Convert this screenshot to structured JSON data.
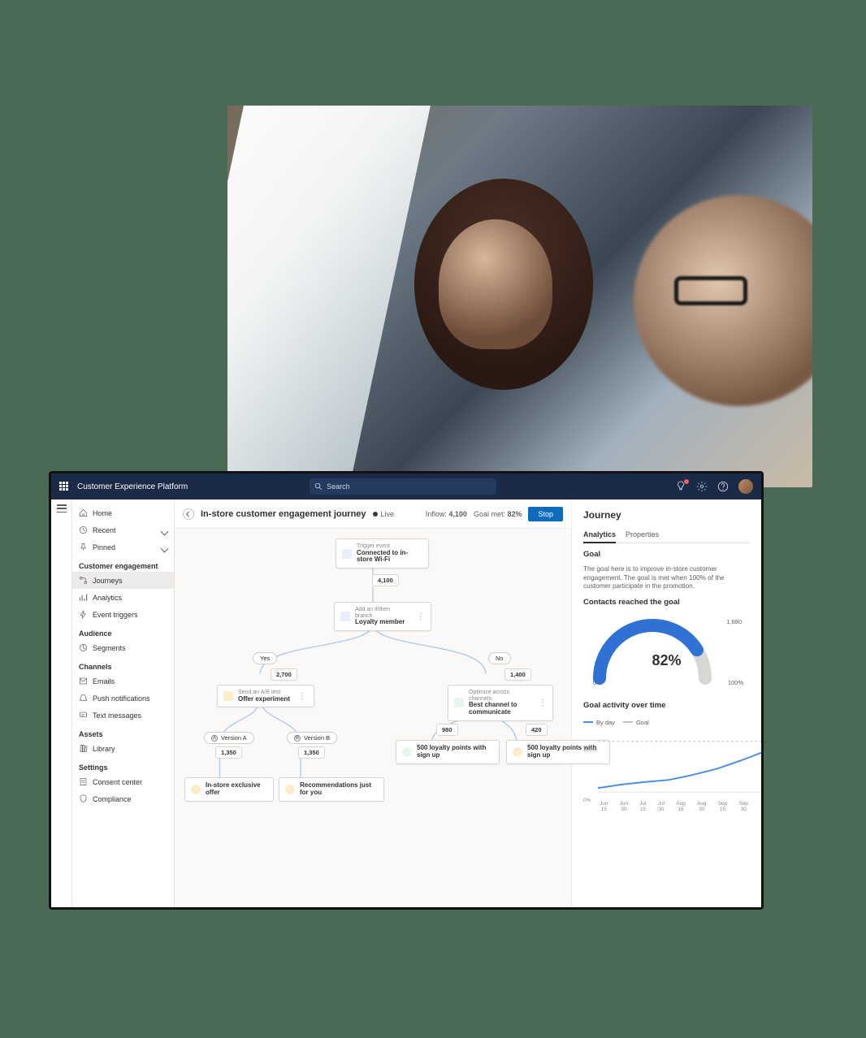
{
  "topbar": {
    "app_title": "Customer Experience Platform",
    "search_placeholder": "Search"
  },
  "sidebar": {
    "items": [
      {
        "icon": "home",
        "label": "Home"
      },
      {
        "icon": "clock",
        "label": "Recent",
        "chev": true
      },
      {
        "icon": "pin",
        "label": "Pinned",
        "chev": true
      }
    ],
    "groups": [
      {
        "title": "Customer engagement",
        "items": [
          {
            "icon": "route",
            "label": "Journeys",
            "active": true
          },
          {
            "icon": "chart",
            "label": "Analytics"
          },
          {
            "icon": "bolt",
            "label": "Event triggers"
          }
        ]
      },
      {
        "title": "Audience",
        "items": [
          {
            "icon": "segment",
            "label": "Segments"
          }
        ]
      },
      {
        "title": "Channels",
        "items": [
          {
            "icon": "mail",
            "label": "Emails"
          },
          {
            "icon": "bell",
            "label": "Push notifications"
          },
          {
            "icon": "sms",
            "label": "Text messages"
          }
        ]
      },
      {
        "title": "Assets",
        "items": [
          {
            "icon": "lib",
            "label": "Library"
          }
        ]
      },
      {
        "title": "Settings",
        "items": [
          {
            "icon": "consent",
            "label": "Consent center"
          },
          {
            "icon": "shield",
            "label": "Compliance"
          }
        ]
      }
    ]
  },
  "header": {
    "title": "In-store customer engagement journey",
    "status": "Live",
    "inflow_label": "Inflow:",
    "inflow_value": "4,100",
    "goal_label": "Goal met:",
    "goal_value": "82%",
    "stop": "Stop"
  },
  "flow": {
    "trigger": {
      "type": "Trigger event",
      "label": "Connected to in-store Wi-Fi"
    },
    "count1": "4,100",
    "attr": {
      "type": "Add an if/then branch",
      "label": "Loyalty member"
    },
    "branch_yes": "Yes",
    "branch_no": "No",
    "left_count": "2,700",
    "right_count": "1,400",
    "left_node": {
      "type": "Send an A/B test",
      "label": "Offer experiment"
    },
    "right_node": {
      "type": "Optimize across channels",
      "label": "Best channel to communicate"
    },
    "va": "Version A",
    "vb": "Version B",
    "va_n": "1,350",
    "vb_n": "1,350",
    "r_a_n": "980",
    "r_b_n": "420",
    "loyalty": "500 loyalty points with sign up",
    "end_a": "In-store exclusive offer",
    "end_b": "Recommendations just for you"
  },
  "panel": {
    "title": "Journey",
    "tab_analytics": "Analytics",
    "tab_properties": "Properties",
    "goal_heading": "Goal",
    "goal_text": "The goal here is to improve in-store customer engagement. The goal is met when 100% of the customer participate in the promotion.",
    "gauge_heading": "Contacts reached the goal",
    "gauge_center": "82%",
    "gauge_min": "0",
    "gauge_count": "1,680",
    "gauge_max": "100%",
    "line_heading": "Goal activity over time",
    "legend_a": "By day",
    "legend_b": "Goal",
    "y_top": "100%",
    "y_bot": "0%"
  },
  "chart_data": {
    "gauge": {
      "type": "gauge",
      "value": 82,
      "max": 100,
      "count": 1680
    },
    "line": {
      "type": "line",
      "categories": [
        "Jun 15",
        "Jun 30",
        "Jul 15",
        "Jul 30",
        "Aug 15",
        "Aug 30",
        "Sep 15",
        "Sep 30"
      ],
      "series": [
        {
          "name": "By day",
          "values": [
            8,
            15,
            20,
            24,
            34,
            46,
            62,
            80
          ]
        },
        {
          "name": "Goal",
          "values": [
            100,
            100,
            100,
            100,
            100,
            100,
            100,
            100
          ]
        }
      ],
      "ylim": [
        0,
        100
      ],
      "ylabel": "",
      "xlabel": ""
    }
  },
  "colors": {
    "accent": "#0f6cbd",
    "gauge_track": "#d9d7d4",
    "line": "#4c8fdb",
    "goal_line": "#bfbfbf"
  }
}
